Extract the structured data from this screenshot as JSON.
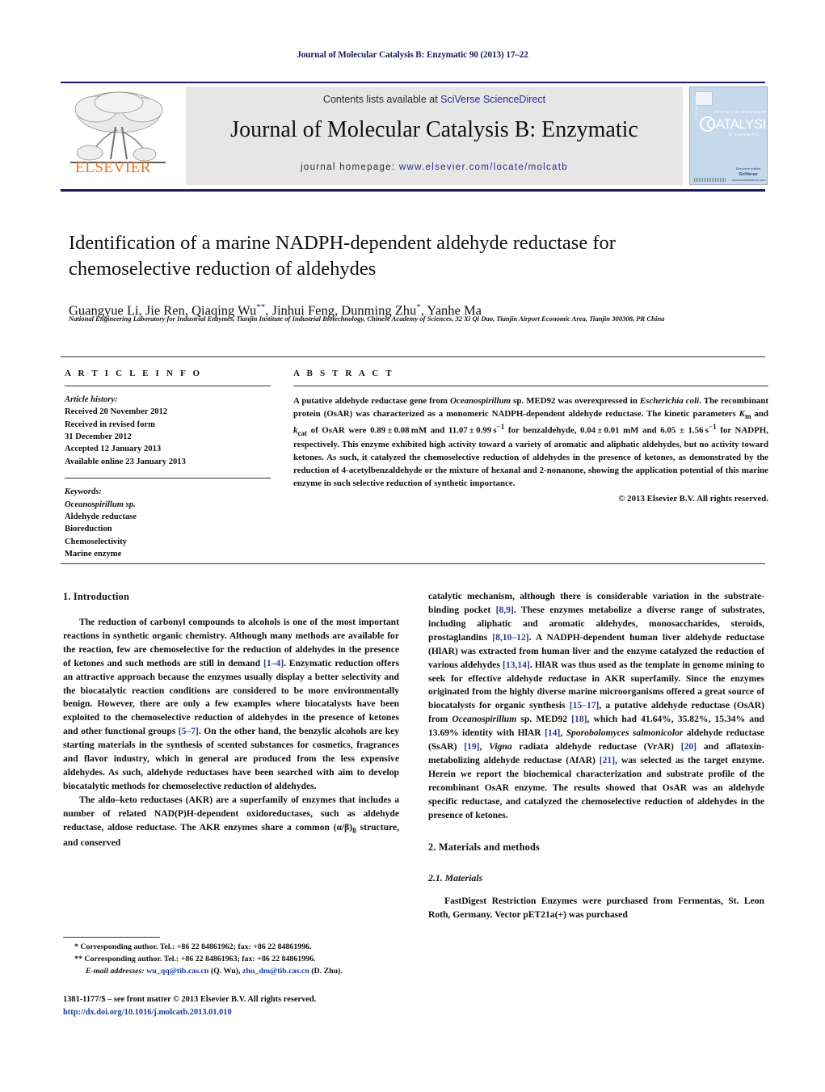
{
  "running_head": "Journal of Molecular Catalysis B: Enzymatic 90 (2013) 17–22",
  "masthead": {
    "contents_prefix": "Contents lists available at ",
    "contents_link": "SciVerse ScienceDirect",
    "journal_name": "Journal of Molecular Catalysis B: Enzymatic",
    "homepage_prefix": "journal homepage: ",
    "homepage_url": "www.elsevier.com/locate/molcatb",
    "publisher": "ELSEVIER",
    "cover": {
      "journal_small": "JOURNAL OF MOLECULAR",
      "main": "CATALYSIS",
      "sub": "B: ENZYMATIC",
      "vertical": "ISSN 1381-1177",
      "editor_label": "Executive editors",
      "editor_name": "SciVerse",
      "editor_extra": "www.sciencedirect.com"
    },
    "accent_color": "#2b2b8f",
    "elsevier_orange": "#E87722"
  },
  "article": {
    "title": "Identification of a marine NADPH-dependent aldehyde reductase for chemoselective reduction of aldehydes",
    "authors_html": "Guangyue Li, Jie Ren, Qiaqing Wu<sup>**</sup>, Jinhui Feng, Dunming Zhu<sup>*</sup>, Yanhe Ma",
    "affiliation": "National Engineering Laboratory for Industrial Enzymes, Tianjin Institute of Industrial Biotechnology, Chinese Academy of Sciences, 32 Xi Qi Dao, Tianjin Airport Economic Area, Tianjin 300308, PR China"
  },
  "article_info": {
    "heading": "A R T I C L E   I N F O",
    "history_label": "Article history:",
    "history": [
      "Received 20 November 2012",
      "Received in revised form",
      "31 December 2012",
      "Accepted 12 January 2013",
      "Available online 23 January 2013"
    ],
    "keywords_label": "Keywords:",
    "keywords": [
      "Oceanospirillum sp.",
      "Aldehyde reductase",
      "Bioreduction",
      "Chemoselectivity",
      "Marine enzyme"
    ]
  },
  "abstract": {
    "heading": "A B S T R A C T",
    "text_html": "A putative aldehyde reductase gene from <i>Oceanospirillum</i> sp. MED92 was overexpressed in <i>Escherichia coli</i>. The recombinant protein (OsAR) was characterized as a monomeric NADPH-dependent aldehyde reductase. The kinetic parameters <i>K</i><sub>m</sub> and <i>k</i><sub>cat</sub> of OsAR were 0.89&thinsp;±&thinsp;0.08&thinsp;mM and 11.07&thinsp;±&thinsp;0.99&thinsp;s<sup>−1</sup> for benzaldehyde, 0.04&thinsp;±&thinsp;0.01 mM and 6.05 ± 1.56&thinsp;s<sup>−1</sup> for NADPH, respectively. This enzyme exhibited high activity toward a variety of aromatic and aliphatic aldehydes, but no activity toward ketones. As such, it catalyzed the chemoselective reduction of aldehydes in the presence of ketones, as demonstrated by the reduction of 4-acetylbenzaldehyde or the mixture of hexanal and 2-nonanone, showing the application potential of this marine enzyme in such selective reduction of synthetic importance.",
    "copyright": "© 2013 Elsevier B.V. All rights reserved."
  },
  "body": {
    "left": {
      "section_1_heading": "1.  Introduction",
      "para_1_html": "The reduction of carbonyl compounds to alcohols is one of the most important reactions in synthetic organic chemistry. Although many methods are available for the reaction, few are chemoselective for the reduction of aldehydes in the presence of ketones and such methods are still in demand <span class=\"ref\">[1–4]</span>. Enzymatic reduction offers an attractive approach because the enzymes usually display a better selectivity and the biocatalytic reaction conditions are considered to be more environmentally benign. However, there are only a few examples where biocatalysts have been exploited to the chemoselective reduction of aldehydes in the presence of ketones and other functional groups <span class=\"ref\">[5–7]</span>. On the other hand, the benzylic alcohols are key starting materials in the synthesis of scented substances for cosmetics, fragrances and flavor industry, which in general are produced from the less expensive aldehydes. As such, aldehyde reductases have been searched with aim to develop biocatalytic methods for chemoselective reduction of aldehydes.",
      "para_2_html": "The aldo–keto reductases (AKR) are a superfamily of enzymes that includes a number of related NAD(P)H-dependent oxidoreductases, such as aldehyde reductase, aldose reductase. The AKR enzymes share a common (α/β)<sub>8</sub> structure, and conserved"
    },
    "right": {
      "para_1_html": "catalytic mechanism, although there is considerable variation in the substrate-binding pocket <span class=\"ref\">[8,9]</span>. These enzymes metabolize a diverse range of substrates, including aliphatic and aromatic aldehydes, monosaccharides, steroids, prostaglandins <span class=\"ref\">[8,10–12]</span>. A NADPH-dependent human liver aldehyde reductase (HlAR) was extracted from human liver and the enzyme catalyzed the reduction of various aldehydes <span class=\"ref\">[13,14]</span>. HlAR was thus used as the template in genome mining to seek for effective aldehyde reductase in AKR superfamily. Since the enzymes originated from the highly diverse marine microorganisms offered a great source of biocatalysts for organic synthesis <span class=\"ref\">[15–17]</span>, a putative aldehyde reductase (OsAR) from <i>Oceanospirillum</i> sp. MED92 <span class=\"ref\">[18]</span>, which had 41.64%, 35.82%, 15.34% and 13.69% identity with HlAR <span class=\"ref\">[14]</span>, <i>Sporobolomyces salmonicolor</i> aldehyde reductase (SsAR) <span class=\"ref\">[19]</span>, <i>Vigna</i> radiata aldehyde reductase (VrAR) <span class=\"ref\">[20]</span> and aflatoxin-metabolizing aldehyde reductase (AfAR) <span class=\"ref\">[21]</span>, was selected as the target enzyme. Herein we report the biochemical characterization and substrate profile of the recombinant OsAR enzyme. The results showed that OsAR was an aldehyde specific reductase, and catalyzed the chemoselective reduction of aldehydes in the presence of ketones.",
      "section_2_heading": "2.  Materials and methods",
      "subsection_21_heading": "2.1.  Materials",
      "para_2_html": "FastDigest Restriction Enzymes were purchased from Fermentas, St. Leon Roth, Germany. Vector pET21a(+) was purchased"
    }
  },
  "footnotes": {
    "line_1": "*  Corresponding author. Tel.: +86 22 84861962; fax: +86 22 84861996.",
    "line_2": "**  Corresponding author. Tel.: +86 22 84861963; fax: +86 22 84861996.",
    "email_label": "E-mail addresses:",
    "email_1": "wu_qq@tib.cas.cn",
    "email_1_owner": "(Q. Wu),",
    "email_2": "zhu_dm@tib.cas.cn",
    "email_2_owner": "(D. Zhu)."
  },
  "imprint": {
    "line_1": "1381-1177/$ – see front matter © 2013 Elsevier B.V. All rights reserved.",
    "doi": "http://dx.doi.org/10.1016/j.molcatb.2013.01.010"
  }
}
